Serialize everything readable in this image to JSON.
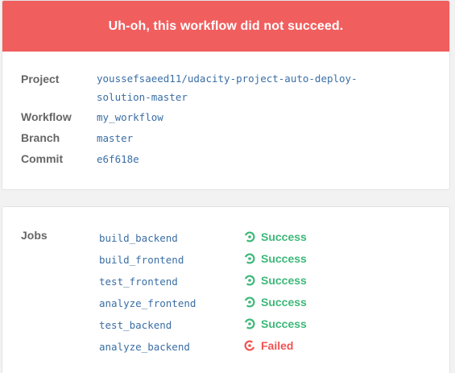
{
  "banner": {
    "message": "Uh-oh, this workflow did not succeed."
  },
  "details": {
    "project_label": "Project",
    "project_value_line1": "youssefsaeed11/udacity-project-auto-deploy-",
    "project_value_line2": "solution-master",
    "workflow_label": "Workflow",
    "workflow_value": "my_workflow",
    "branch_label": "Branch",
    "branch_value": "master",
    "commit_label": "Commit",
    "commit_value": "e6f618e"
  },
  "jobs": {
    "label": "Jobs",
    "items": [
      {
        "name": "build_backend",
        "status": "Success"
      },
      {
        "name": "build_frontend",
        "status": "Success"
      },
      {
        "name": "test_frontend",
        "status": "Success"
      },
      {
        "name": "analyze_frontend",
        "status": "Success"
      },
      {
        "name": "test_backend",
        "status": "Success"
      },
      {
        "name": "analyze_backend",
        "status": "Failed"
      }
    ]
  },
  "colors": {
    "banner_bg": "#f15e5e",
    "success": "#3cb878",
    "failed": "#ef5350",
    "link": "#3a6ea5"
  },
  "icons": {
    "success": "success-icon",
    "failed": "failed-icon"
  }
}
